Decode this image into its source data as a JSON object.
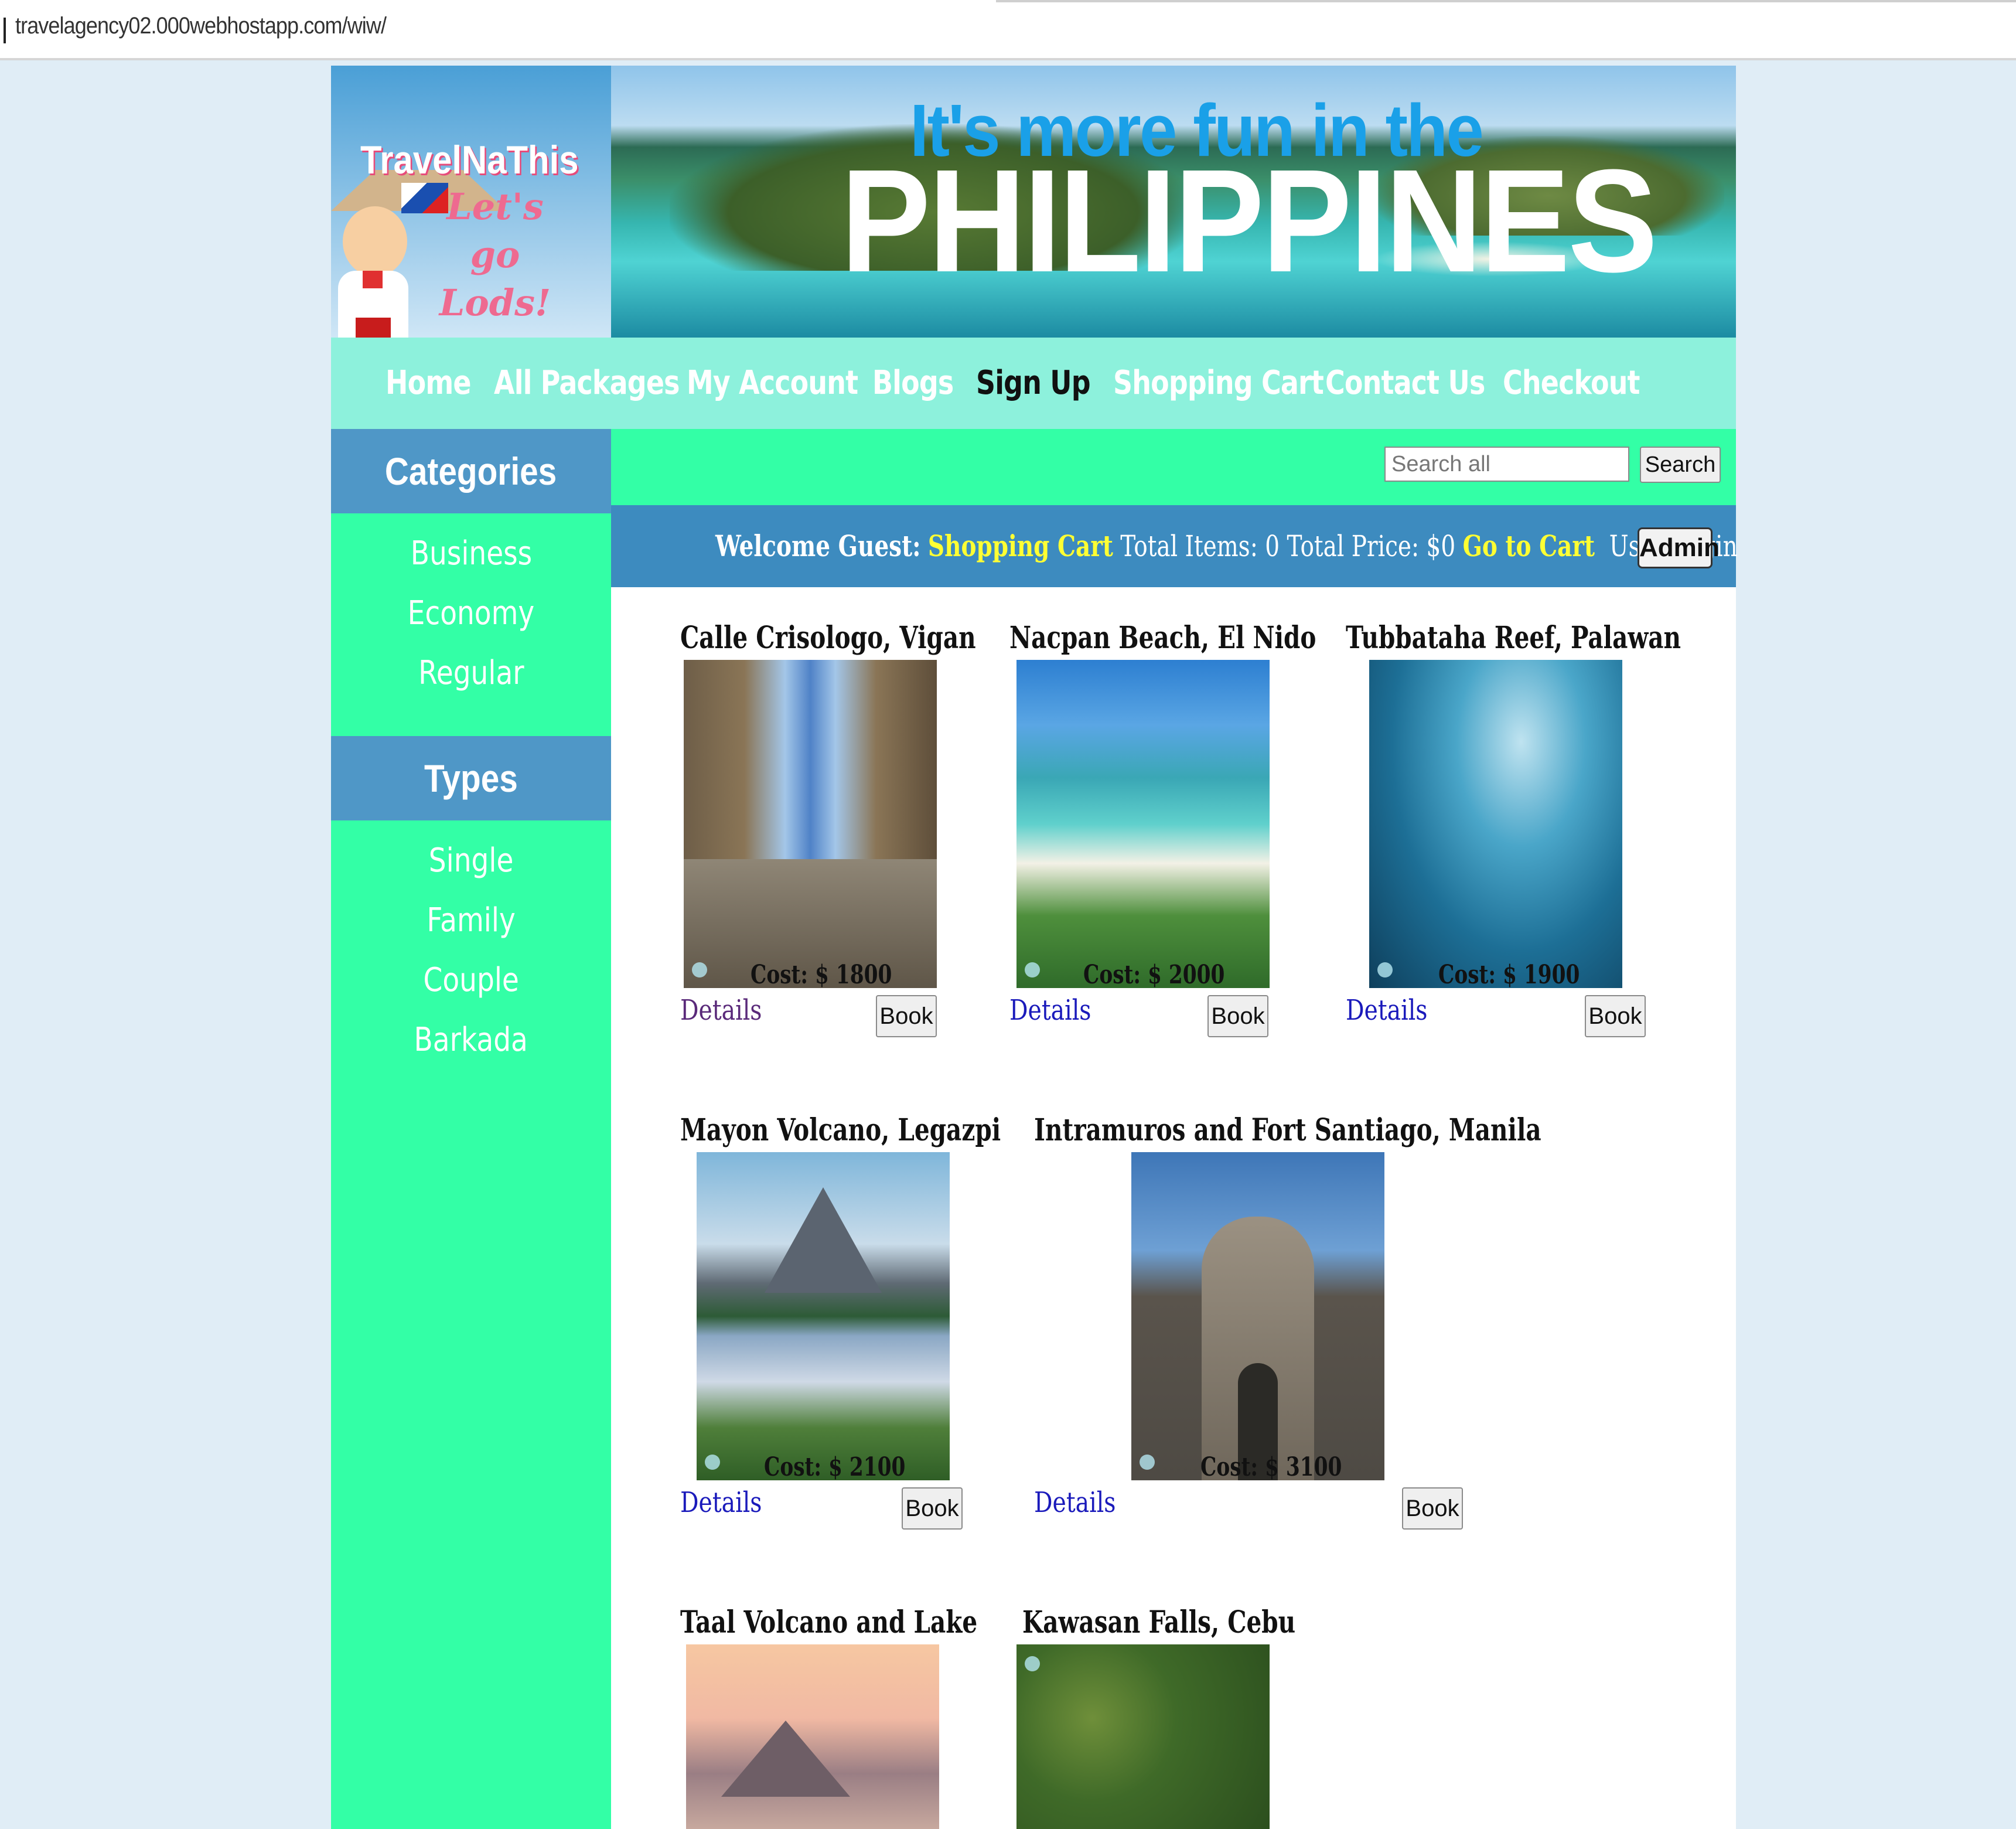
{
  "browser": {
    "url": "travelagency02.000webhostapp.com/wiw/"
  },
  "header": {
    "logo_title": "TravelNaThis",
    "logo_tagline": "Let's go Lods!",
    "banner_line1": "It's more fun in the",
    "banner_line2": "PHILIPPINES"
  },
  "nav": {
    "items": [
      "Home",
      "All Packages",
      "My Account",
      "Blogs",
      "Sign Up",
      "Shopping Cart",
      "Contact Us",
      "Checkout"
    ],
    "active": "Sign Up"
  },
  "sidebar": {
    "categories_title": "Categories",
    "categories": [
      "Business",
      "Economy",
      "Regular"
    ],
    "types_title": "Types",
    "types": [
      "Single",
      "Family",
      "Couple",
      "Barkada"
    ]
  },
  "search": {
    "placeholder": "Search all",
    "button": "Search"
  },
  "welcome": {
    "greeting": "Welcome Guest:",
    "cart_label": "Shopping Cart",
    "total_items": "Total Items: 0",
    "total_price": "Total Price: $0",
    "go_to_cart": "Go to Cart",
    "user_login": "User Login",
    "admin": "Admin"
  },
  "packages": [
    {
      "title": "Calle Crisologo, Vigan",
      "cost": "Cost: $ 1800",
      "details": "Details",
      "book": "Book"
    },
    {
      "title": "Nacpan Beach, El Nido",
      "cost": "Cost: $ 2000",
      "details": "Details",
      "book": "Book"
    },
    {
      "title": "Tubbataha Reef, Palawan",
      "cost": "Cost: $ 1900",
      "details": "Details",
      "book": "Book"
    },
    {
      "title": "Mayon Volcano, Legazpi",
      "cost": "Cost: $ 2100",
      "details": "Details",
      "book": "Book"
    },
    {
      "title": "Intramuros and Fort Santiago, Manila",
      "cost": "Cost: $ 3100",
      "details": "Details",
      "book": "Book"
    },
    {
      "title": "Taal Volcano and Lake"
    },
    {
      "title": "Kawasan Falls, Cebu"
    }
  ],
  "colors": {
    "background": "#e0edf6",
    "nav_bg": "#8df1dc",
    "sidebar_bg": "#33ffa6",
    "heading_bg": "#4f97c7",
    "welcome_bg": "#3d8bbf",
    "highlight": "#ffff33"
  }
}
